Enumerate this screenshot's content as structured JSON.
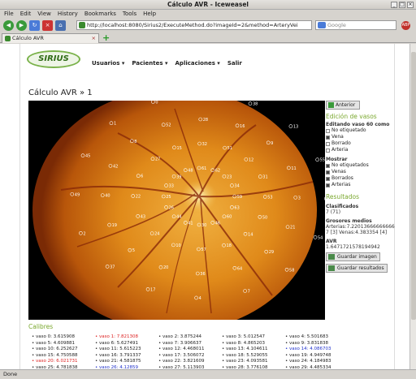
{
  "window": {
    "title": "Cálculo AVR - Iceweasel"
  },
  "menu": [
    "File",
    "Edit",
    "View",
    "History",
    "Bookmarks",
    "Tools",
    "Help"
  ],
  "nav": {
    "url": "http://localhost:8080/Sirius2/ExecuteMethod.do?imageId=2&method=ArteryVei",
    "search_placeholder": "Google",
    "abp": "ABP"
  },
  "tab": {
    "label": "Cálculo AVR"
  },
  "app": {
    "logo": "SIRIUS",
    "menu": [
      "Usuarios ▾",
      "Pacientes ▾",
      "Aplicaciones ▾",
      "Salir"
    ],
    "title": "Cálculo AVR » 1"
  },
  "side": {
    "back": "Anterior",
    "edit_title": "Edición de vasos",
    "editing": "Editando vaso 60 como",
    "edit_opts": [
      {
        "label": "No etiquetado",
        "on": false
      },
      {
        "label": "Vena",
        "on": true
      },
      {
        "label": "Borrado",
        "on": false
      },
      {
        "label": "Arteria",
        "on": false
      }
    ],
    "show_title": "Mostrar",
    "show_opts": [
      {
        "label": "No etiquetados",
        "on": true
      },
      {
        "label": "Venas",
        "on": true
      },
      {
        "label": "Borrados",
        "on": true
      },
      {
        "label": "Arterias",
        "on": true
      }
    ],
    "results_title": "Resultados",
    "classified_label": "Clasificados",
    "classified_value": "7 (71)",
    "thick_label": "Grosores medios",
    "thick_value": "Arterias:7.220136666666667 [3] Venas:4.383354 [4]",
    "avr_label": "AVR",
    "avr_value": "1.6471721578194942",
    "save_image": "Guardar imagen",
    "save_results": "Guardar resultados"
  },
  "calibres": {
    "title": "Calibres",
    "items": [
      {
        "t": "vaso 0: 3.615908",
        "c": ""
      },
      {
        "t": "vaso 1: 7.821308",
        "c": "red"
      },
      {
        "t": "vaso 2: 3.875244",
        "c": ""
      },
      {
        "t": "vaso 3: 5.012547",
        "c": ""
      },
      {
        "t": "vaso 4: 5.501683",
        "c": ""
      },
      {
        "t": "vaso 5: 4.609881",
        "c": ""
      },
      {
        "t": "vaso 6: 5.627491",
        "c": ""
      },
      {
        "t": "vaso 7: 3.906637",
        "c": ""
      },
      {
        "t": "vaso 8: 4.865203",
        "c": ""
      },
      {
        "t": "vaso 9: 3.831838",
        "c": ""
      },
      {
        "t": "vaso 10: 6.252627",
        "c": ""
      },
      {
        "t": "vaso 11: 5.615223",
        "c": ""
      },
      {
        "t": "vaso 12: 4.468011",
        "c": ""
      },
      {
        "t": "vaso 13: 4.104611",
        "c": ""
      },
      {
        "t": "vaso 14: 4.086703",
        "c": "blue"
      },
      {
        "t": "vaso 15: 4.750588",
        "c": ""
      },
      {
        "t": "vaso 16: 3.791337",
        "c": ""
      },
      {
        "t": "vaso 17: 3.506072",
        "c": ""
      },
      {
        "t": "vaso 18: 5.529055",
        "c": ""
      },
      {
        "t": "vaso 19: 4.949748",
        "c": ""
      },
      {
        "t": "vaso 20: 6.021731",
        "c": "red"
      },
      {
        "t": "vaso 21: 4.581875",
        "c": ""
      },
      {
        "t": "vaso 22: 3.821609",
        "c": ""
      },
      {
        "t": "vaso 23: 4.093581",
        "c": ""
      },
      {
        "t": "vaso 24: 4.184983",
        "c": ""
      },
      {
        "t": "vaso 25: 4.781838",
        "c": ""
      },
      {
        "t": "vaso 26: 4.12859",
        "c": "blue"
      },
      {
        "t": "vaso 27: 5.113903",
        "c": ""
      },
      {
        "t": "vaso 28: 3.776108",
        "c": ""
      },
      {
        "t": "vaso 29: 4.485334",
        "c": ""
      }
    ]
  },
  "vessel_labels": [
    "59",
    "63",
    "60",
    "46",
    "30",
    "41",
    "44",
    "26",
    "25",
    "33",
    "39",
    "48",
    "61",
    "62",
    "23",
    "34",
    "50",
    "14",
    "18",
    "57",
    "10",
    "24",
    "43",
    "22",
    "6",
    "27",
    "15",
    "32",
    "51",
    "12",
    "31",
    "53",
    "29",
    "64",
    "36",
    "20",
    "5",
    "19",
    "40",
    "42",
    "8",
    "52",
    "28",
    "16",
    "9",
    "11",
    "3",
    "21",
    "7",
    "4",
    "17",
    "37",
    "2",
    "49",
    "45",
    "1",
    "0",
    "47",
    "38",
    "13",
    "55",
    "56",
    "54",
    "58",
    "65"
  ],
  "status": "Done"
}
